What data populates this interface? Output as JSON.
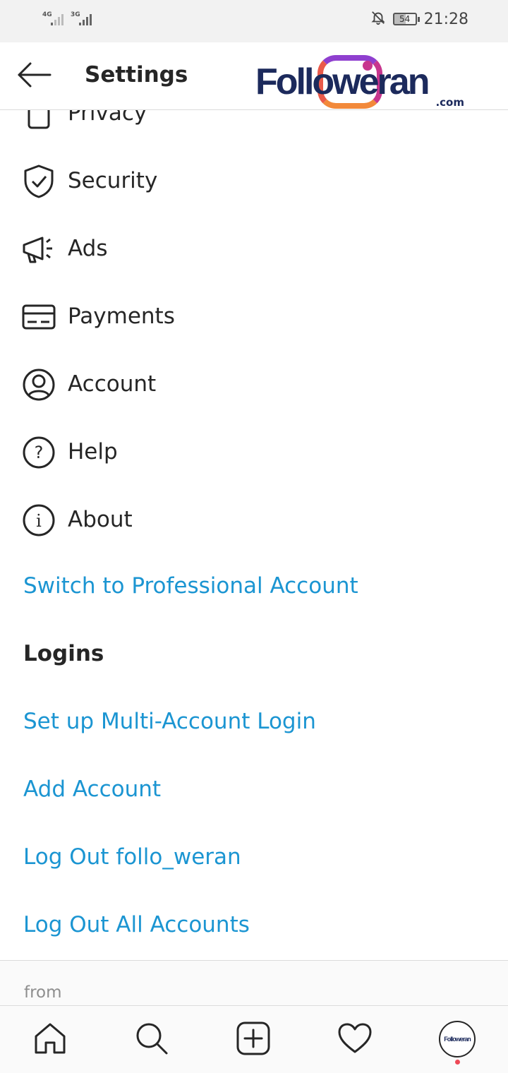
{
  "status_bar": {
    "net1": "4G",
    "net2": "3G",
    "battery": "54",
    "time": "21:28"
  },
  "header": {
    "title": "Settings",
    "brand": {
      "text": "Followeran",
      "suffix": ".com"
    }
  },
  "menu": {
    "items": [
      {
        "label": "Privacy",
        "icon": "lock-icon"
      },
      {
        "label": "Security",
        "icon": "shield-check-icon"
      },
      {
        "label": "Ads",
        "icon": "megaphone-icon"
      },
      {
        "label": "Payments",
        "icon": "credit-card-icon"
      },
      {
        "label": "Account",
        "icon": "user-circle-icon"
      },
      {
        "label": "Help",
        "icon": "question-circle-icon"
      },
      {
        "label": "About",
        "icon": "info-circle-icon"
      }
    ],
    "switch_pro": "Switch to Professional Account",
    "logins_title": "Logins",
    "login_links": [
      "Set up Multi-Account Login",
      "Add Account",
      "Log Out follo_weran",
      "Log Out All Accounts"
    ],
    "footer_from": "from"
  },
  "bottom_nav": {
    "items": [
      "home-icon",
      "search-icon",
      "new-post-icon",
      "activity-heart-icon",
      "profile-avatar"
    ],
    "avatar_text": "Followeran"
  },
  "colors": {
    "link": "#1b95d2",
    "text": "#262626",
    "muted": "#8e8e8e",
    "notification": "#ed4956"
  }
}
